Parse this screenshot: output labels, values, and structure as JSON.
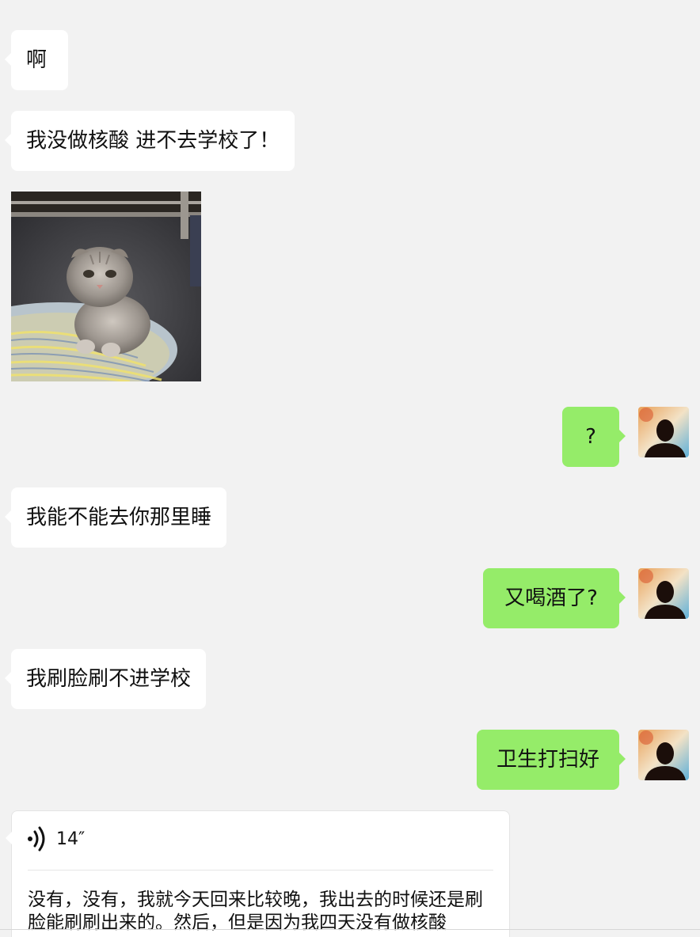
{
  "messages": {
    "m1": "啊",
    "m2": "我没做核酸 进不去学校了！",
    "m3": "?",
    "m4": "我能不能去你那里睡",
    "m5": "又喝酒了?",
    "m6": "我刷脸刷不进学校",
    "m7": "卫生打扫好"
  },
  "voice": {
    "icon": "voice-wave-icon",
    "duration": "14″",
    "transcript": "没有，没有，我就今天回来比较晚，我出去的时候还是刷脸能刷刷出来的。然后，但是因为我四天没有做核酸"
  },
  "images": {
    "sticker": "kitten-photo",
    "avatar": "silhouette-avatar"
  },
  "colors": {
    "background": "#f2f2f2",
    "incoming": "#ffffff",
    "outgoing": "#95ec69"
  }
}
